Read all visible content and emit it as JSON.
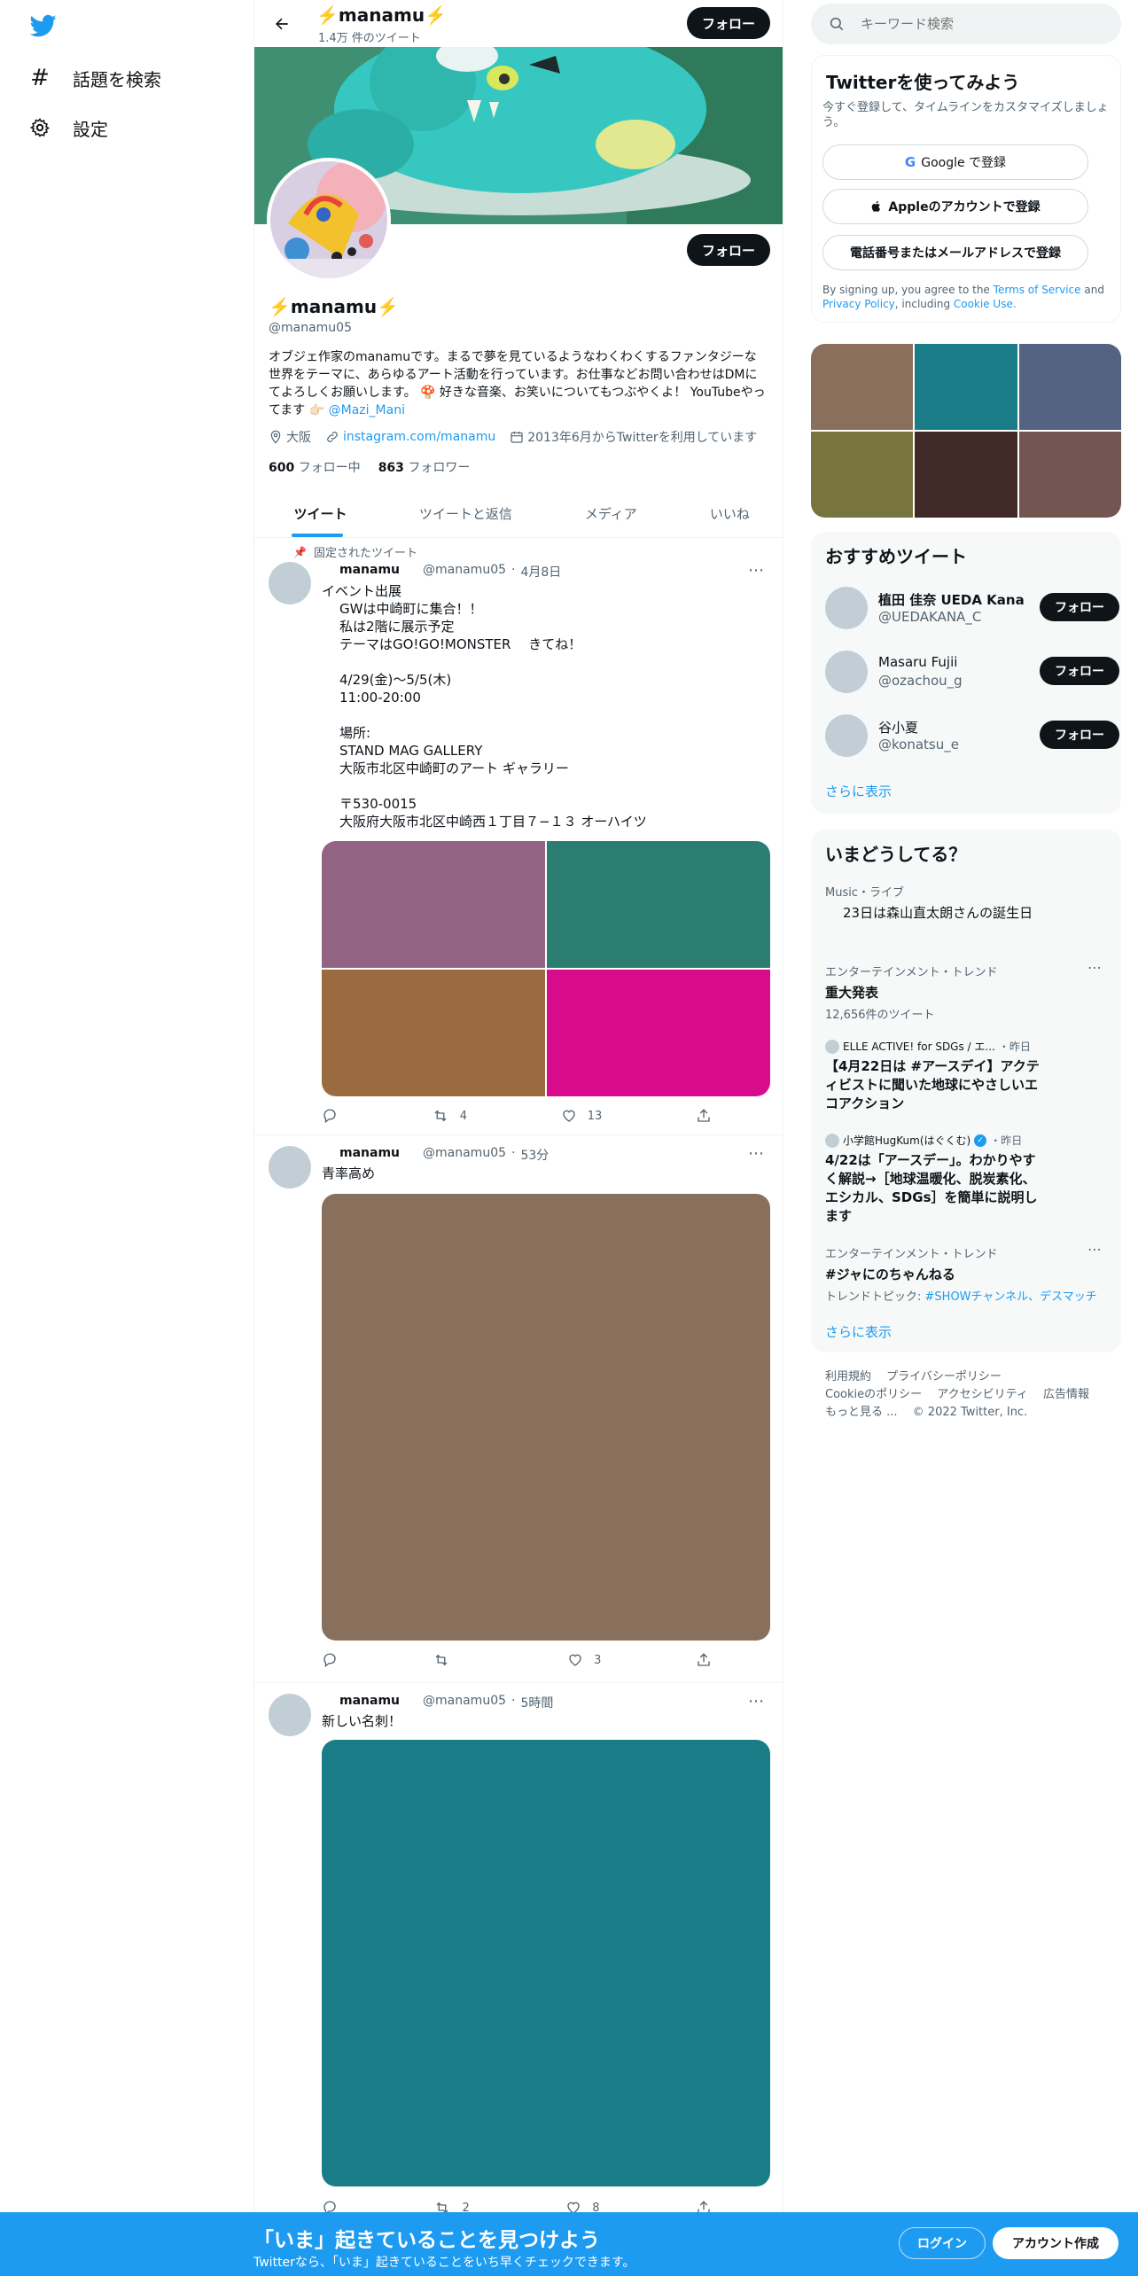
{
  "nav": {
    "explore_label": "話題を検索",
    "settings_label": "設定"
  },
  "header": {
    "name": "⚡️manamu⚡️",
    "tweet_count": "1.4万 件のツイート",
    "follow_label": "フォロー"
  },
  "profile": {
    "name": "⚡️manamu⚡️",
    "handle": "@manamu05",
    "bio": "オブジェ作家のmanamuです。まるで夢を見ているようなわくわくするファンタジーな世界をテーマに、あらゆるアート活動を行っています。お仕事などお問い合わせはDMにてよろしくお願いします。 🍄 好きな音楽、お笑いについてもつぶやくよ！ YouTubeやってます 👉🏻",
    "bio_mention": "@Mazi_Mani",
    "location": "大阪",
    "url": "instagram.com/manamu",
    "joined": "2013年6月からTwitterを利用しています",
    "following_count": "600",
    "following_label": "フォロー中",
    "followers_count": "863",
    "followers_label": "フォロワー",
    "follow_label": "フォロー"
  },
  "tabs": [
    "ツイート",
    "ツイートと返信",
    "メディア",
    "いいね"
  ],
  "tweets": [
    {
      "pinned_label": "固定されたツイート",
      "name": "manamu",
      "handle": "@manamu05",
      "time": "4月8日",
      "text": "イベント出展\nGWは中崎町に集合！！\n私は2階に展示予定\nテーマはGO!GO!MONSTER　 きてね！\n\n4/29(金)～5/5(木)\n11:00-20:00\n\n場所:\nSTAND MAG GALLERY\n大阪市北区中崎町のアート ギャラリー\n\n〒530-0015\n大阪府大阪市北区中崎西１丁目７−１３ オーハイツ",
      "image_colors": [
        "#936384",
        "#2b7d71",
        "#9a6b3f",
        "#d70b8b"
      ],
      "retweets": "4",
      "likes": "13"
    },
    {
      "name": "manamu",
      "handle": "@manamu05",
      "time": "53分",
      "text": "青率高め",
      "image_colors": [
        "#88705d"
      ],
      "likes": "3"
    },
    {
      "name": "manamu",
      "handle": "@manamu05",
      "time": "5時間",
      "text": "新しい名刺！",
      "image_colors": [
        "#1a7c87"
      ],
      "retweets": "2",
      "likes": "8"
    }
  ],
  "search": {
    "placeholder": "キーワード検索"
  },
  "signup": {
    "title": "Twitterを使ってみよう",
    "subtitle": "今すぐ登録して、タイムラインをカスタマイズしましょう。",
    "google_label": "Google で登録",
    "apple_label": "Appleのアカウントで登録",
    "phone_label": "電話番号またはメールアドレスで登録",
    "legal_prefix": "By signing up, you agree to the",
    "terms_label": "Terms of Service",
    "and_label": "and",
    "privacy_label": "Privacy Policy",
    "including_label": ", including",
    "cookie_label": "Cookie Use."
  },
  "media_grid": {
    "colors": [
      "#8a6f5d",
      "#1a7c87",
      "#546381",
      "#787440",
      "#3f2a27",
      "#735651"
    ]
  },
  "who_to_follow": {
    "title": "おすすめツイート",
    "users": [
      {
        "name": "植田 佳奈 UEDA Kana",
        "handle": "@UEDAKANA_C",
        "follow_label": "フォロー"
      },
      {
        "name": "Masaru Fujii",
        "handle": "@ozachou_g",
        "follow_label": "フォロー"
      },
      {
        "name": "谷小夏",
        "handle": "@konatsu_e",
        "follow_label": "フォロー"
      }
    ],
    "show_more": "さらに表示"
  },
  "trends": {
    "title": "いまどうしてる？",
    "items": [
      {
        "context": "Music・ライブ",
        "title": "23日は森山直太朗さんの誕生日"
      },
      {
        "context": "エンターテインメント・トレンド",
        "title": "重大発表",
        "count": "12,656件のツイート"
      },
      {
        "source": "ELLE ACTIVE! for SDGs / エ...",
        "time": "・昨日",
        "title": "【4月22日は #アースデイ】アクティビストに聞いた地球にやさしいエコアクション"
      },
      {
        "source": "小学館HugKum(はぐくむ)",
        "time": "・昨日",
        "title": "4/22は「アースデー」。わかりやすく解説→［地球温暖化、脱炭素化、エシカル、SDGs］を簡単に説明します"
      },
      {
        "context": "エンターテインメント・トレンド",
        "title": "#ジャにのちゃんねる",
        "topic_prefix": "トレンドトピック:",
        "topic_links": "#SHOWチャンネル、デスマッチ"
      }
    ],
    "show_more": "さらに表示"
  },
  "footer": {
    "links": [
      "利用規約",
      "プライバシーポリシー",
      "Cookieのポリシー",
      "アクセシビリティ",
      "広告情報",
      "もっと見る ..."
    ],
    "copyright": "© 2022 Twitter, Inc."
  },
  "bottom_bar": {
    "title": "「いま」起きていることを見つけよう",
    "subtitle": "Twitterなら、「いま」起きていることをいち早くチェックできます。",
    "login_label": "ログイン",
    "signup_label": "アカウント作成"
  },
  "colors": {
    "accent": "#1d9bf0",
    "bottom_bar": "#1d9bf0"
  }
}
